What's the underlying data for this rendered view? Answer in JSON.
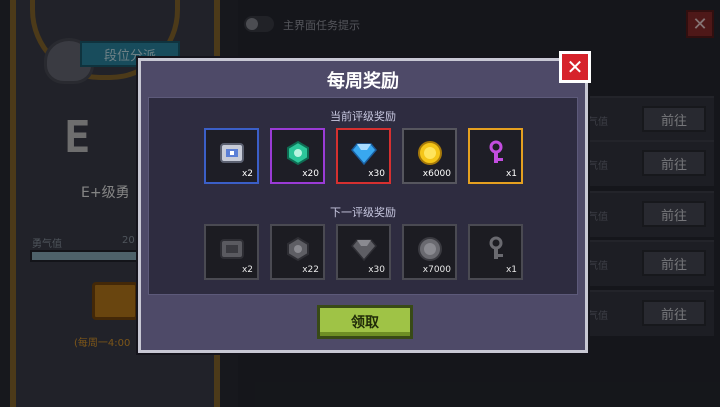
{
  "background": {
    "rank_tab": "段位分派",
    "rank_letter": "E",
    "rank_name": "E+级勇",
    "courage_label": "勇气值",
    "courage_value": "20",
    "weekly_note": "(每周一4:00",
    "toggle_label": "主界面任务提示",
    "close_glyph": "✕",
    "rows": [
      {
        "text": "气值",
        "button": "前往"
      },
      {
        "text": "气值",
        "button": "前往"
      },
      {
        "text": "气值",
        "button": "前往"
      },
      {
        "text": "气值",
        "button": "前往"
      },
      {
        "text": "气值",
        "button": "前往"
      }
    ]
  },
  "modal": {
    "title": "每周奖励",
    "close_glyph": "✕",
    "current_section": {
      "title": "当前评级奖励",
      "items": [
        {
          "icon": "chest-badge-icon",
          "count": "x2",
          "quality": "blue"
        },
        {
          "icon": "green-gem-icon",
          "count": "x20",
          "quality": "purple"
        },
        {
          "icon": "blue-diamond-icon",
          "count": "x30",
          "quality": "red"
        },
        {
          "icon": "gold-coin-icon",
          "count": "x6000",
          "quality": "plain"
        },
        {
          "icon": "purple-key-icon",
          "count": "x1",
          "quality": "gold"
        }
      ]
    },
    "next_section": {
      "title": "下一评级奖励",
      "items": [
        {
          "icon": "chest-badge-icon",
          "count": "x2"
        },
        {
          "icon": "green-gem-icon",
          "count": "x22"
        },
        {
          "icon": "blue-diamond-icon",
          "count": "x30"
        },
        {
          "icon": "gold-coin-icon",
          "count": "x7000"
        },
        {
          "icon": "purple-key-icon",
          "count": "x1"
        }
      ]
    },
    "claim_button": "领取"
  },
  "colors": {
    "modal_bg": "#4e4a68",
    "close_red": "#d6232b",
    "claim_green": "#9fc346"
  }
}
